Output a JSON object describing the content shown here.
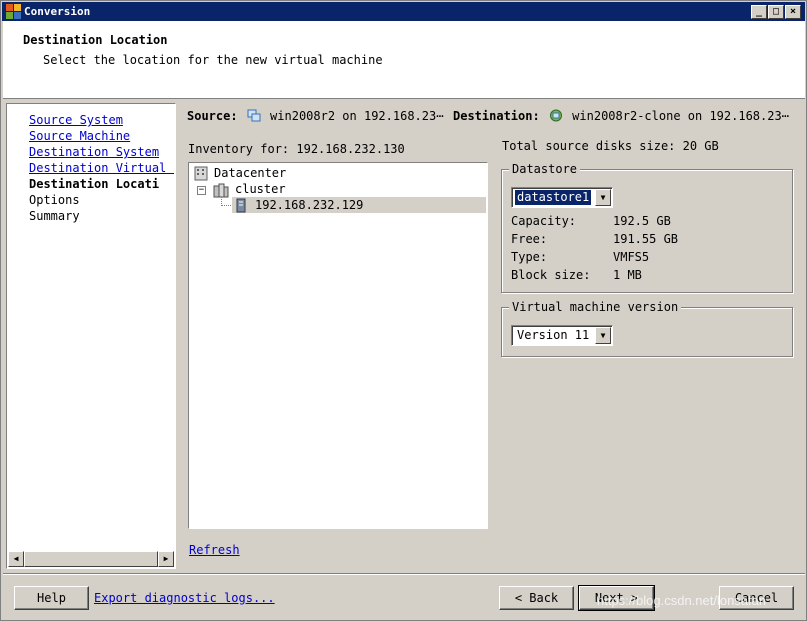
{
  "window": {
    "title": "Conversion",
    "controls": {
      "minimize": "_",
      "maximize": "□",
      "close": "×"
    }
  },
  "header": {
    "title": "Destination Location",
    "subtitle": "Select the location for the new virtual machine"
  },
  "nav": {
    "items": [
      {
        "label": "Source System",
        "state": "link"
      },
      {
        "label": "Source Machine",
        "state": "link"
      },
      {
        "label": "Destination System",
        "state": "link"
      },
      {
        "label": "Destination Virtual M",
        "state": "link"
      },
      {
        "label": "Destination Locati",
        "state": "current"
      },
      {
        "label": "Options",
        "state": "plain"
      },
      {
        "label": "Summary",
        "state": "plain"
      }
    ]
  },
  "summary_bar": {
    "source_label": "Source:",
    "source_value": "win2008r2 on 192.168.23⋯",
    "destination_label": "Destination:",
    "destination_value": "win2008r2-clone on 192.168.23⋯"
  },
  "inventory": {
    "label": "Inventory for: 192.168.232.130",
    "tree": {
      "datacenter": "Datacenter",
      "cluster": "cluster",
      "host": "192.168.232.129"
    },
    "refresh": "Refresh"
  },
  "disk_info": {
    "total": "Total source disks size: 20 GB"
  },
  "datastore": {
    "group_label": "Datastore",
    "selected": "datastore1",
    "capacity_label": "Capacity:",
    "capacity_value": "192.5 GB",
    "free_label": "Free:",
    "free_value": "191.55 GB",
    "type_label": "Type:",
    "type_value": "VMFS5",
    "block_label": "Block size:",
    "block_value": "1 MB"
  },
  "vm_version": {
    "group_label": "Virtual machine version",
    "selected": "Version 11"
  },
  "footer": {
    "help": "Help",
    "export": "Export diagnostic logs...",
    "back": "< Back",
    "next": "Next >",
    "cancel": "Cancel",
    "watermark": "https://blog.csdn.net/lonsafan"
  },
  "colors": {
    "titlebar": "#0a246a",
    "link": "#0000cc",
    "selection": "#0a246a",
    "face": "#d4d0c8"
  }
}
